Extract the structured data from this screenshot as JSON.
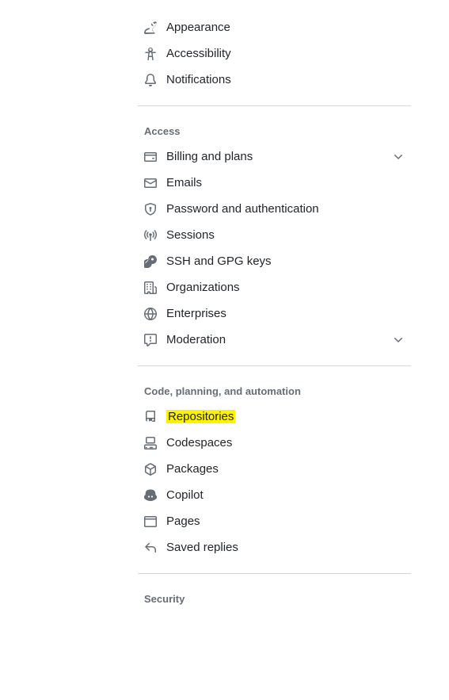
{
  "top": {
    "appearance": "Appearance",
    "accessibility": "Accessibility",
    "notifications": "Notifications"
  },
  "access": {
    "title": "Access",
    "billing": "Billing and plans",
    "emails": "Emails",
    "password": "Password and authentication",
    "sessions": "Sessions",
    "ssh": "SSH and GPG keys",
    "organizations": "Organizations",
    "enterprises": "Enterprises",
    "moderation": "Moderation"
  },
  "code": {
    "title": "Code, planning, and automation",
    "repositories": "Repositories",
    "codespaces": "Codespaces",
    "packages": "Packages",
    "copilot": "Copilot",
    "pages": "Pages",
    "saved": "Saved replies"
  },
  "security": {
    "title": "Security"
  }
}
